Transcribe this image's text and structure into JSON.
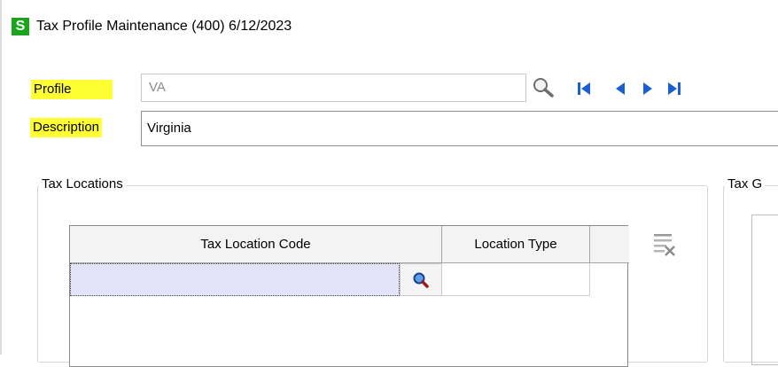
{
  "window": {
    "app_icon_letter": "S",
    "title": "Tax Profile Maintenance (400) 6/12/2023"
  },
  "profile": {
    "label": "Profile",
    "value": "VA"
  },
  "description": {
    "label": "Description",
    "value": "Virginia"
  },
  "navigation": {
    "icons": [
      "search-icon",
      "first-record-icon",
      "previous-record-icon",
      "next-record-icon",
      "last-record-icon"
    ]
  },
  "tax_locations": {
    "legend": "Tax Locations",
    "columns": [
      "Tax Location Code",
      "Location Type"
    ],
    "rows": [
      {
        "tax_location_code": "",
        "location_type": ""
      }
    ],
    "delete_icon": "delete-row-icon"
  },
  "tax_groups": {
    "legend": "Tax G"
  },
  "colors": {
    "highlight": "#ffff33",
    "app_icon": "#1aa51a",
    "nav_blue": "#1a5fd0",
    "selected_cell": "#e3e3fb"
  }
}
